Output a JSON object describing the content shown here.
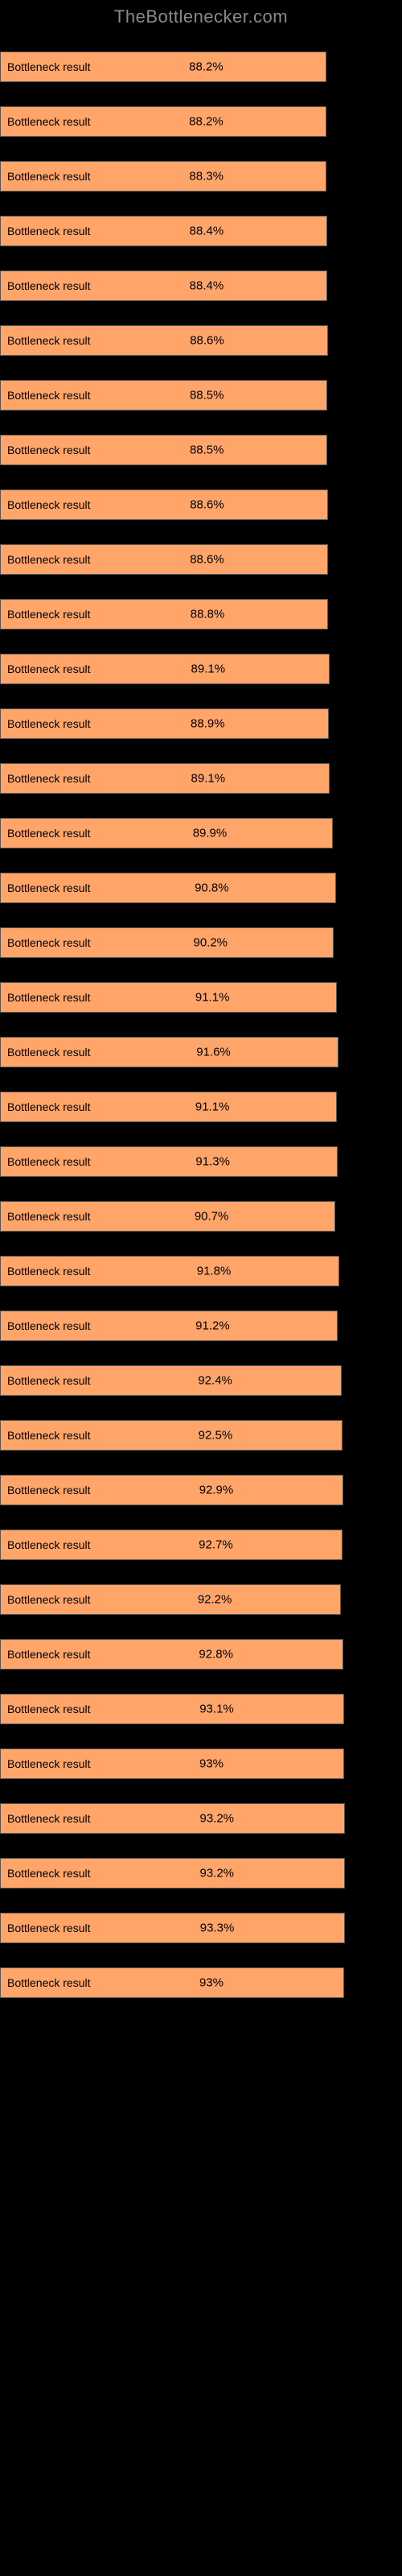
{
  "header": "TheBottlenecker.com",
  "bar_label": "Bottleneck result",
  "bar_color": "#ffa569",
  "chart_data": {
    "type": "bar",
    "title": "",
    "xlabel": "",
    "ylabel": "",
    "xlim": [
      0,
      100
    ],
    "categories": [
      "Bottleneck result",
      "Bottleneck result",
      "Bottleneck result",
      "Bottleneck result",
      "Bottleneck result",
      "Bottleneck result",
      "Bottleneck result",
      "Bottleneck result",
      "Bottleneck result",
      "Bottleneck result",
      "Bottleneck result",
      "Bottleneck result",
      "Bottleneck result",
      "Bottleneck result",
      "Bottleneck result",
      "Bottleneck result",
      "Bottleneck result",
      "Bottleneck result",
      "Bottleneck result",
      "Bottleneck result",
      "Bottleneck result",
      "Bottleneck result",
      "Bottleneck result",
      "Bottleneck result",
      "Bottleneck result",
      "Bottleneck result",
      "Bottleneck result",
      "Bottleneck result",
      "Bottleneck result",
      "Bottleneck result",
      "Bottleneck result",
      "Bottleneck result",
      "Bottleneck result",
      "Bottleneck result",
      "Bottleneck result",
      "Bottleneck result"
    ],
    "values": [
      88.2,
      88.2,
      88.3,
      88.4,
      88.4,
      88.6,
      88.5,
      88.5,
      88.6,
      88.6,
      88.8,
      89.1,
      88.9,
      89.1,
      89.9,
      90.8,
      90.2,
      91.1,
      91.6,
      91.1,
      91.3,
      90.7,
      91.8,
      91.2,
      92.4,
      92.5,
      92.9,
      92.7,
      92.2,
      92.8,
      93.1,
      93.0,
      93.2,
      93.2,
      93.3,
      93.0
    ],
    "display": [
      "88.2%",
      "88.2%",
      "88.3%",
      "88.4%",
      "88.4%",
      "88.6%",
      "88.5%",
      "88.5%",
      "88.6%",
      "88.6%",
      "88.8%",
      "89.1%",
      "88.9%",
      "89.1%",
      "89.9%",
      "90.8%",
      "90.2%",
      "91.1%",
      "91.6%",
      "91.1%",
      "91.3%",
      "90.7%",
      "91.8%",
      "91.2%",
      "92.4%",
      "92.5%",
      "92.9%",
      "92.7%",
      "92.2%",
      "92.8%",
      "93.1%",
      "93%",
      "93.2%",
      "93.2%",
      "93.3%",
      "93%"
    ]
  }
}
